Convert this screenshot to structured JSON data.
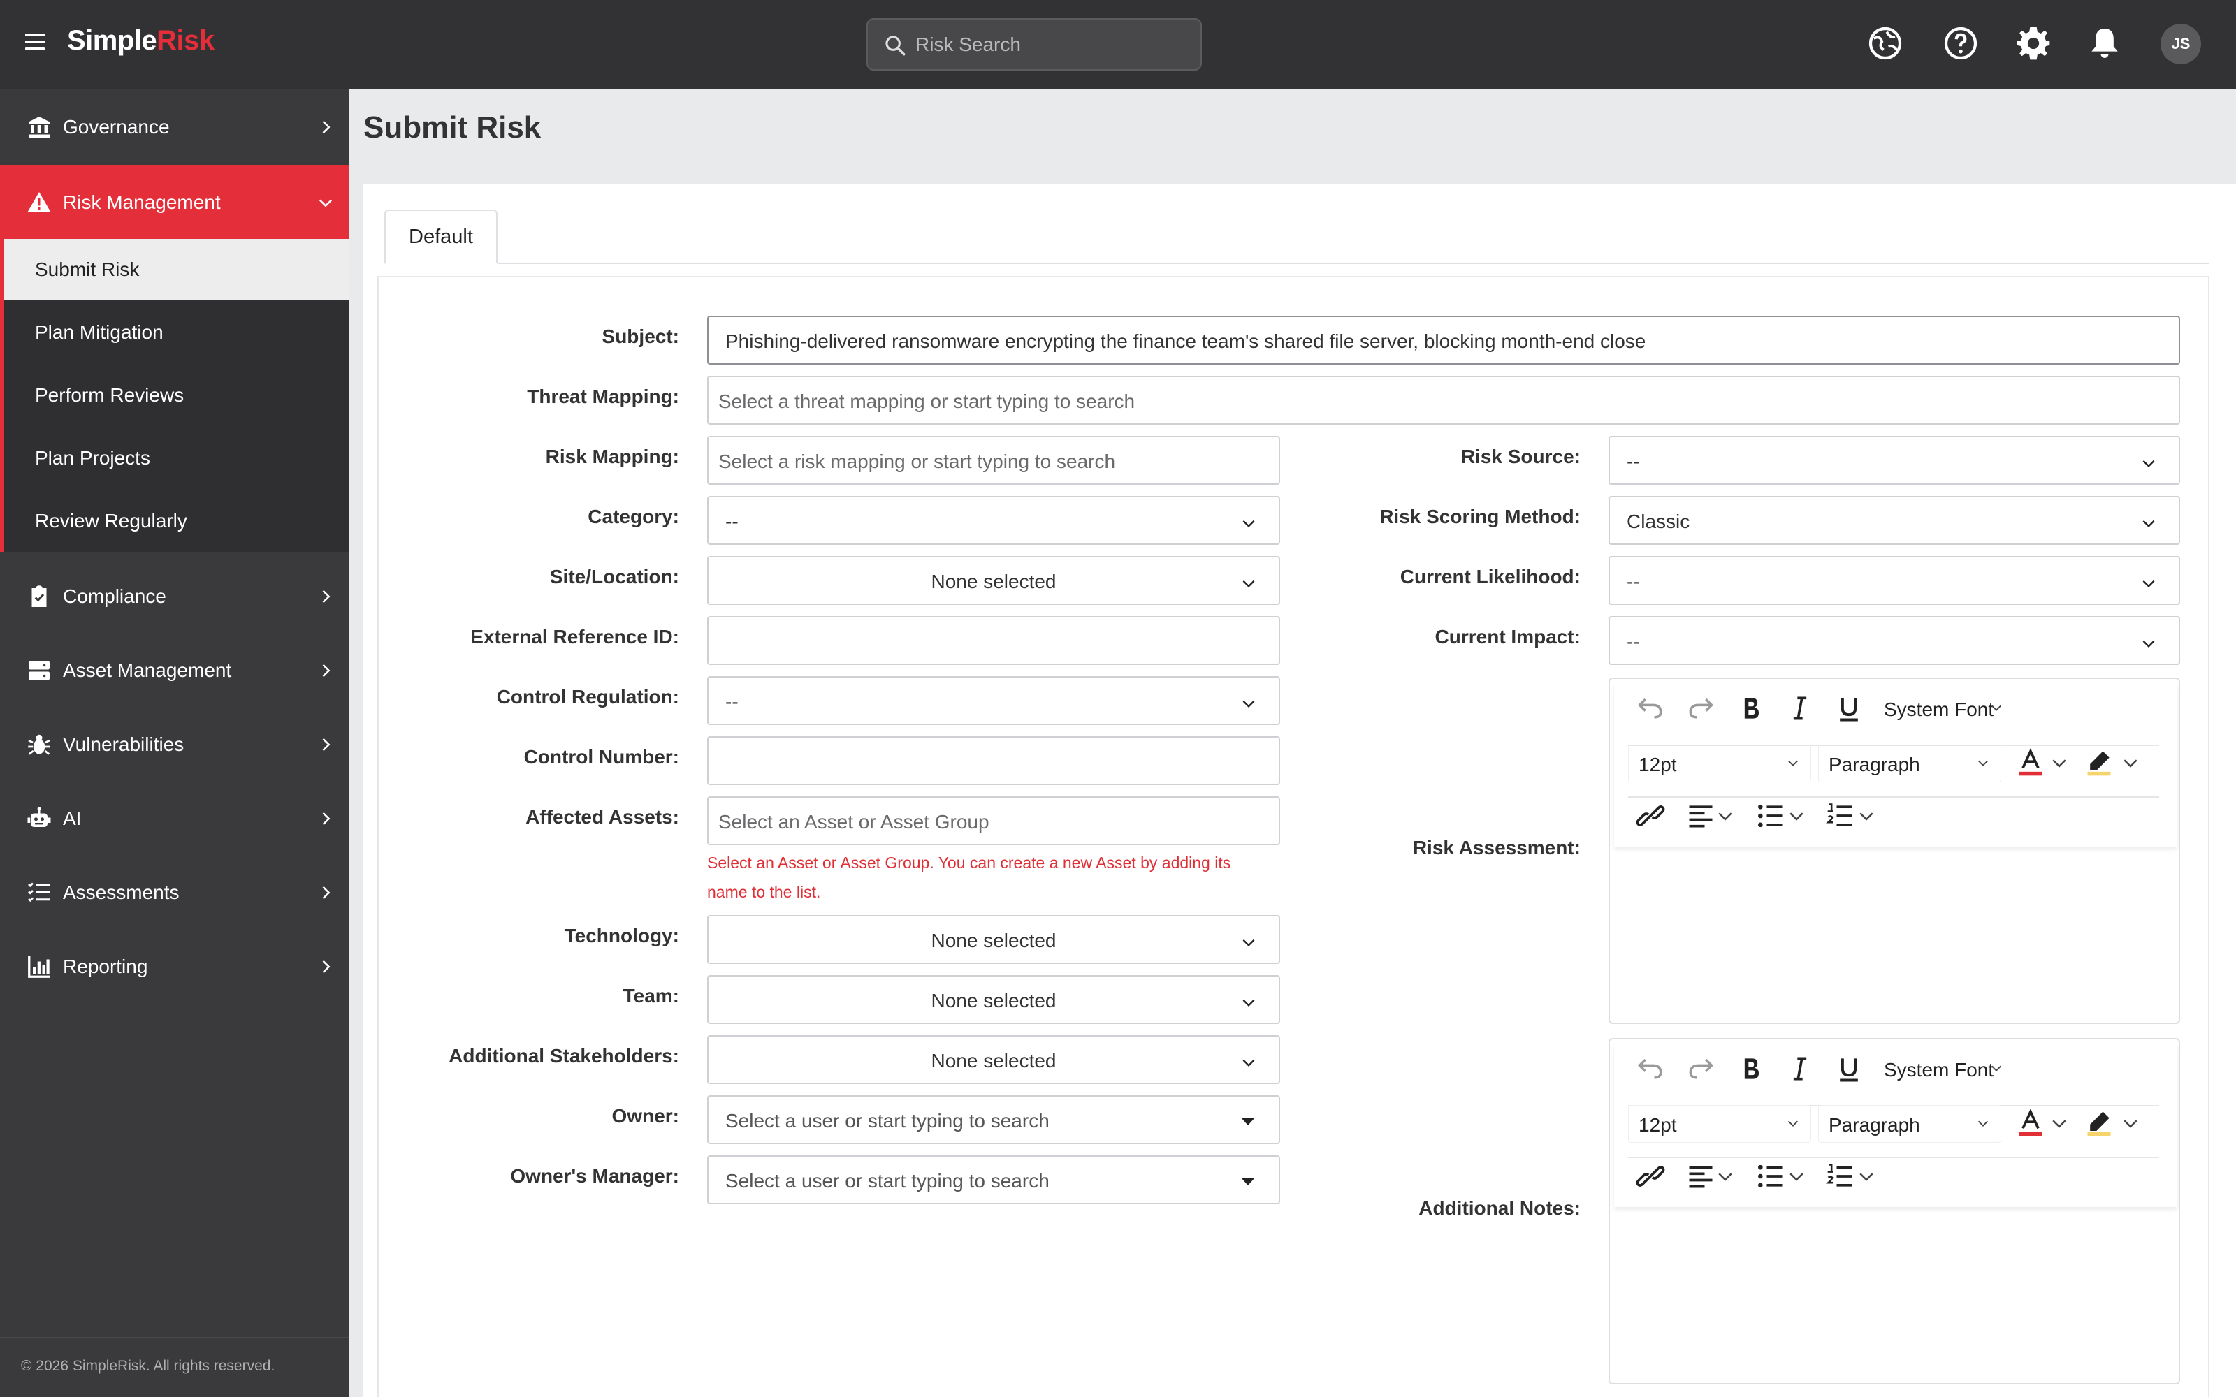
{
  "app": {
    "logo_main": "Simple",
    "logo_accent": "Risk"
  },
  "header": {
    "search_placeholder": "Risk Search",
    "icons": [
      "language-icon",
      "help-icon",
      "settings-icon",
      "notifications-icon"
    ],
    "user_initials": "JS"
  },
  "sidebar": {
    "items": [
      {
        "label": "Governance",
        "icon": "bank-icon"
      },
      {
        "label": "Risk Management",
        "icon": "warning-icon",
        "active": true
      },
      {
        "label": "Compliance",
        "icon": "clipboard-check-icon"
      },
      {
        "label": "Asset Management",
        "icon": "server-icon"
      },
      {
        "label": "Vulnerabilities",
        "icon": "bug-icon"
      },
      {
        "label": "AI",
        "icon": "robot-icon"
      },
      {
        "label": "Assessments",
        "icon": "checklist-icon"
      },
      {
        "label": "Reporting",
        "icon": "bar-chart-icon"
      }
    ],
    "submenu": [
      {
        "label": "Submit Risk",
        "active": true
      },
      {
        "label": "Plan Mitigation"
      },
      {
        "label": "Perform Reviews"
      },
      {
        "label": "Plan Projects"
      },
      {
        "label": "Review Regularly"
      }
    ],
    "footer": "© 2026 SimpleRisk. All rights reserved."
  },
  "page": {
    "title": "Submit Risk",
    "tab": "Default"
  },
  "form": {
    "subject": {
      "label": "Subject:",
      "value": "Phishing-delivered ransomware encrypting the finance team's shared file server, blocking month-end close"
    },
    "threat_mapping": {
      "label": "Threat Mapping:",
      "placeholder": "Select a threat mapping or start typing to search"
    },
    "risk_mapping": {
      "label": "Risk Mapping:",
      "placeholder": "Select a risk mapping or start typing to search"
    },
    "category": {
      "label": "Category:",
      "value": "--"
    },
    "site_location": {
      "label": "Site/Location:",
      "value": "None selected"
    },
    "external_ref": {
      "label": "External Reference ID:",
      "value": ""
    },
    "control_regulation": {
      "label": "Control Regulation:",
      "value": "--"
    },
    "control_number": {
      "label": "Control Number:",
      "value": ""
    },
    "affected_assets": {
      "label": "Affected Assets:",
      "placeholder": "Select an Asset or Asset Group",
      "hint": "Select an Asset or Asset Group. You can create a new Asset by adding its name to the list."
    },
    "technology": {
      "label": "Technology:",
      "value": "None selected"
    },
    "team": {
      "label": "Team:",
      "value": "None selected"
    },
    "stakeholders": {
      "label": "Additional Stakeholders:",
      "value": "None selected"
    },
    "owner": {
      "label": "Owner:",
      "placeholder": "Select a user or start typing to search"
    },
    "owners_manager": {
      "label": "Owner's Manager:",
      "placeholder": "Select a user or start typing to search"
    },
    "risk_source": {
      "label": "Risk Source:",
      "value": "--"
    },
    "scoring_method": {
      "label": "Risk Scoring Method:",
      "value": "Classic"
    },
    "likelihood": {
      "label": "Current Likelihood:",
      "value": "--"
    },
    "impact": {
      "label": "Current Impact:",
      "value": "--"
    },
    "risk_assessment": {
      "label": "Risk Assessment:"
    },
    "additional_notes": {
      "label": "Additional Notes:"
    }
  },
  "editor": {
    "font": "System Font",
    "size": "12pt",
    "block": "Paragraph"
  },
  "colors": {
    "accent": "#e42f3a",
    "topbar": "#323234",
    "sidebar": "#3a3a3c",
    "hint": "#e02f35"
  }
}
